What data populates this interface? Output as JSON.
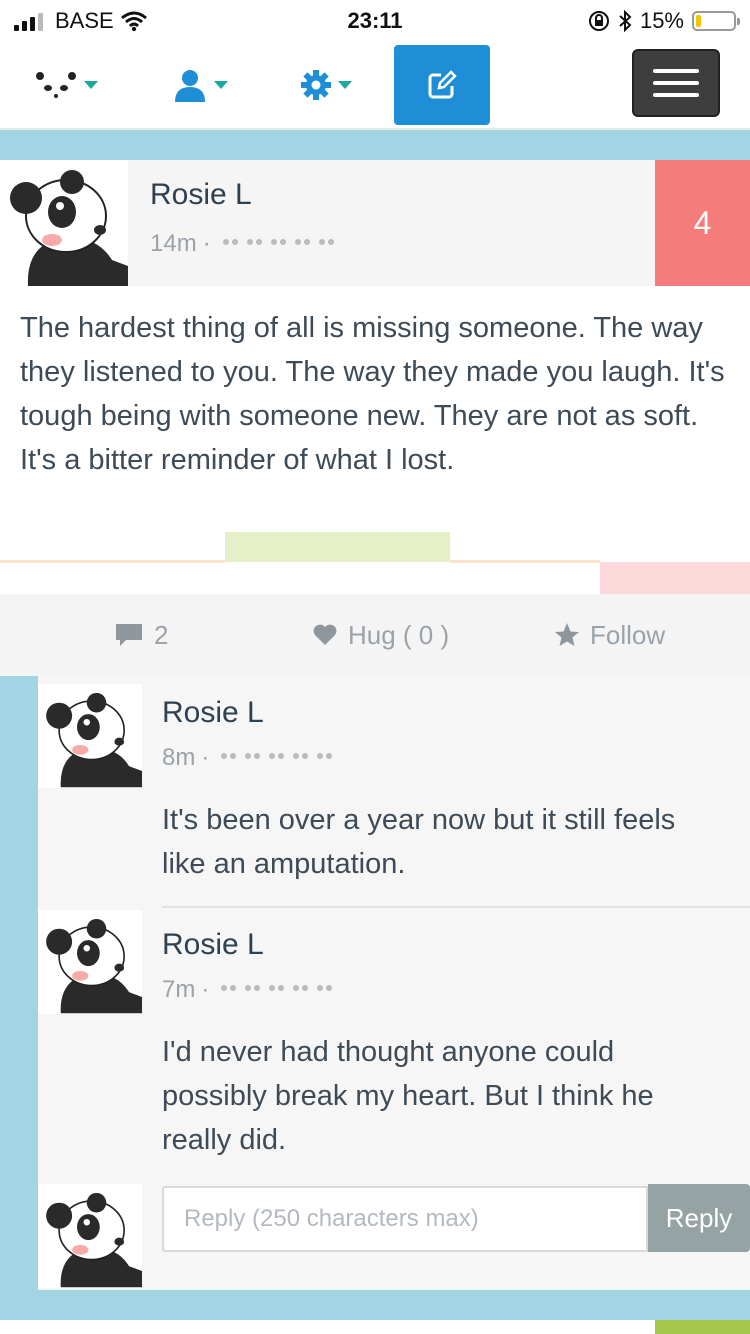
{
  "status_bar": {
    "carrier": "BASE",
    "time": "23:11",
    "battery": "15%",
    "battery_level": 0.15
  },
  "nav": {
    "items": [
      {
        "icon": "panda-icon"
      },
      {
        "icon": "user-icon"
      },
      {
        "icon": "gear-icon"
      },
      {
        "icon": "compose-icon"
      },
      {
        "icon": "hamburger-menu-icon"
      }
    ]
  },
  "post": {
    "author": "Rosie L",
    "time": "14m",
    "separator": "·",
    "count": "4",
    "body": "The hardest thing of all is missing someone. The way they listened to you. The way they made you laugh. It's tough being with someone new. They are not as soft. It's a bitter reminder of what I lost.",
    "actions": {
      "comments": "2",
      "hug": "Hug ( 0 )",
      "follow": "Follow"
    },
    "colors": {
      "count_bg": "#f47d7c",
      "mood_green": "#e5f0c9",
      "mood_peach": "#fbe3c9",
      "mood_pink": "#fbd9da"
    }
  },
  "comments": [
    {
      "author": "Rosie L",
      "time": "8m",
      "separator": "·",
      "text": "It's been over a year now but it still feels like an amputation."
    },
    {
      "author": "Rosie L",
      "time": "7m",
      "separator": "·",
      "text": "I'd never had thought anyone could possibly break my heart. But I think he really did."
    }
  ],
  "reply": {
    "placeholder": "Reply (250 characters max)",
    "button": "Reply"
  }
}
